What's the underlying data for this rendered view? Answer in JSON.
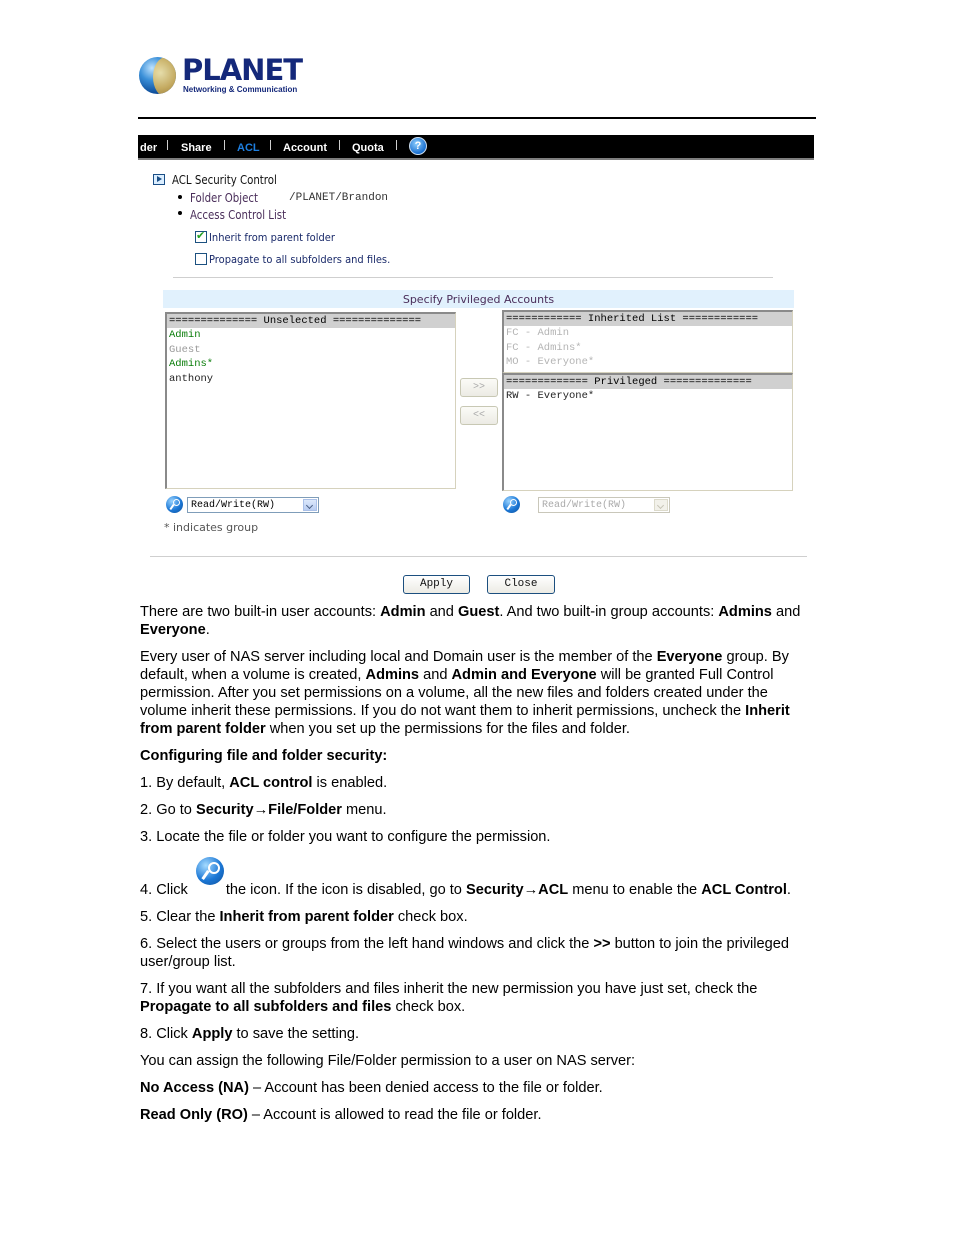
{
  "logo": {
    "name": "PLANET",
    "tagline": "Networking & Communication"
  },
  "navbar": {
    "items": [
      {
        "label": "der",
        "active": false
      },
      {
        "label": "Share",
        "active": false
      },
      {
        "label": "ACL",
        "active": true
      },
      {
        "label": "Account",
        "active": false
      },
      {
        "label": "Quota",
        "active": false
      }
    ],
    "help_icon": "question-mark-icon",
    "help_glyph": "?",
    "active_color": "#1e7fe0"
  },
  "acl": {
    "section_title": "ACL Security Control",
    "folder_object_label": "Folder Object",
    "folder_object_value": "/PLANET/Brandon",
    "acl_list_label": "Access Control List",
    "inherit_checkbox": {
      "label": "Inherit from parent folder",
      "checked": true
    },
    "propagate_checkbox": {
      "label": "Propagate to all subfolders and files.",
      "checked": false
    },
    "specify_title": "Specify Privileged Accounts",
    "unselected": {
      "header": "============== Unselected ==============",
      "items": [
        {
          "label": "Admin",
          "color": "green"
        },
        {
          "label": "Guest",
          "color": "gray"
        },
        {
          "label": "Admins*",
          "color": "green"
        },
        {
          "label": "anthony",
          "color": "dark"
        }
      ]
    },
    "inherited": {
      "header": "============ Inherited List ============",
      "items": [
        "FC - Admin",
        "FC - Admins*",
        "MO - Everyone*"
      ]
    },
    "privileged": {
      "header": "============= Privileged ==============",
      "items": [
        "RW - Everyone*"
      ]
    },
    "add_button": ">>",
    "remove_button": "<<",
    "left_select": {
      "value": "Read/Write(RW)",
      "disabled": false
    },
    "right_select": {
      "value": "Read/Write(RW)",
      "disabled": true
    },
    "group_note": "* indicates group",
    "apply_button": "Apply",
    "close_button": "Close"
  },
  "doc": {
    "p1": [
      "There are two built-in user accounts: ",
      "Admin",
      " and ",
      "Guest",
      ". And two built-in group accounts: ",
      "Admins",
      " and ",
      "Everyone",
      "."
    ],
    "p2": [
      "Every user of NAS server including local and Domain user is the member of the ",
      "Everyone",
      " group. By default, when a volume is created, ",
      "Admins",
      " and ",
      "Admin and Everyone",
      " will be granted Full Control permission. After you set permissions on a volume, all the new files and folders created under the volume inherit these permissions. If you do not want them to inherit permissions, uncheck the ",
      "Inherit from parent folder",
      " when you set up the permissions for the files and folder."
    ],
    "heading": "Configuring file and folder security:",
    "step1": [
      "1. By default, ",
      "ACL control",
      " is enabled."
    ],
    "step2": [
      "2. Go to ",
      "Security→File/Folder",
      " menu."
    ],
    "step3": "3. Locate the file or folder you want to configure the permission.",
    "step4": [
      "4. Click",
      "the icon. If the icon is disabled, go to ",
      "Security→ACL",
      " menu to enable the ",
      "ACL Control",
      "."
    ],
    "step5": [
      "5. Clear the ",
      "Inherit from parent folder",
      " check box."
    ],
    "step6": [
      "6. Select the users or groups from the left hand windows and click the ",
      ">>",
      " button to join the privileged user/group list."
    ],
    "step7": [
      "7. If you want all the subfolders and files inherit the new permission you have just set, check the ",
      "Propagate to all subfolders and files",
      " check box."
    ],
    "step8": [
      "8. Click ",
      "Apply",
      " to save the setting."
    ],
    "p3": "You can assign the following File/Folder permission to a user on NAS server:",
    "perm_na": [
      "No Access (NA)",
      " – Account has been denied access to the file or folder."
    ],
    "perm_ro": [
      "Read Only (RO)",
      " – Account is allowed to read the file or folder."
    ]
  }
}
